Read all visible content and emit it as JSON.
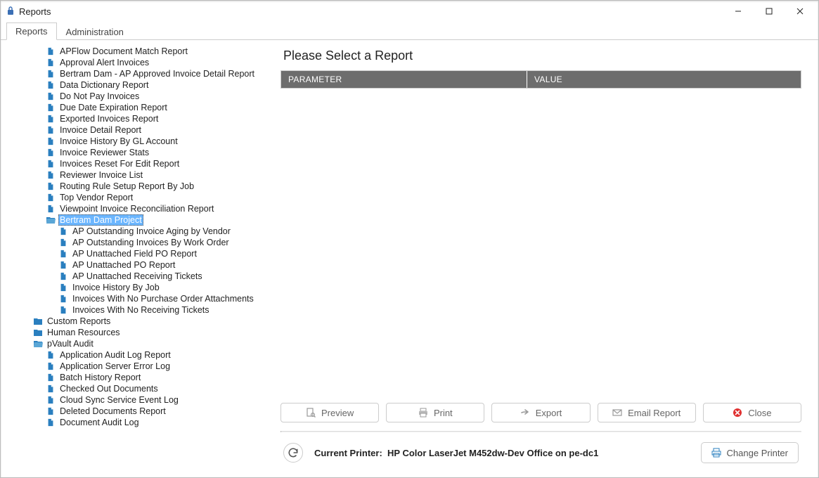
{
  "window": {
    "title": "Reports"
  },
  "tabs": {
    "reports": "Reports",
    "administration": "Administration",
    "active": "reports"
  },
  "tree": [
    {
      "depth": 2,
      "icon": "file",
      "label": "APFlow Document Match Report"
    },
    {
      "depth": 2,
      "icon": "file",
      "label": "Approval Alert Invoices"
    },
    {
      "depth": 2,
      "icon": "file",
      "label": "Bertram Dam - AP Approved Invoice Detail Report"
    },
    {
      "depth": 2,
      "icon": "file",
      "label": "Data Dictionary Report"
    },
    {
      "depth": 2,
      "icon": "file",
      "label": "Do Not Pay Invoices"
    },
    {
      "depth": 2,
      "icon": "file",
      "label": "Due Date Expiration Report"
    },
    {
      "depth": 2,
      "icon": "file",
      "label": "Exported Invoices Report"
    },
    {
      "depth": 2,
      "icon": "file",
      "label": "Invoice Detail Report"
    },
    {
      "depth": 2,
      "icon": "file",
      "label": "Invoice History By GL Account"
    },
    {
      "depth": 2,
      "icon": "file",
      "label": "Invoice Reviewer Stats"
    },
    {
      "depth": 2,
      "icon": "file",
      "label": "Invoices Reset For Edit Report"
    },
    {
      "depth": 2,
      "icon": "file",
      "label": "Reviewer Invoice List"
    },
    {
      "depth": 2,
      "icon": "file",
      "label": "Routing Rule Setup Report By Job"
    },
    {
      "depth": 2,
      "icon": "file",
      "label": "Top Vendor Report"
    },
    {
      "depth": 2,
      "icon": "file",
      "label": "Viewpoint Invoice Reconciliation Report"
    },
    {
      "depth": 2,
      "icon": "folder-open",
      "label": "Bertram Dam Project",
      "selected": true
    },
    {
      "depth": 3,
      "icon": "file",
      "label": "AP Outstanding Invoice Aging by Vendor"
    },
    {
      "depth": 3,
      "icon": "file",
      "label": "AP Outstanding Invoices By Work Order"
    },
    {
      "depth": 3,
      "icon": "file",
      "label": "AP Unattached Field PO Report"
    },
    {
      "depth": 3,
      "icon": "file",
      "label": "AP Unattached PO Report"
    },
    {
      "depth": 3,
      "icon": "file",
      "label": "AP Unattached Receiving Tickets"
    },
    {
      "depth": 3,
      "icon": "file",
      "label": "Invoice History By Job"
    },
    {
      "depth": 3,
      "icon": "file",
      "label": "Invoices With No Purchase Order Attachments"
    },
    {
      "depth": 3,
      "icon": "file",
      "label": "Invoices With No Receiving Tickets"
    },
    {
      "depth": 1,
      "icon": "folder",
      "label": "Custom Reports"
    },
    {
      "depth": 1,
      "icon": "folder",
      "label": "Human Resources"
    },
    {
      "depth": 1,
      "icon": "folder-open",
      "label": "pVault Audit"
    },
    {
      "depth": 2,
      "icon": "file",
      "label": "Application Audit Log Report"
    },
    {
      "depth": 2,
      "icon": "file",
      "label": "Application Server Error Log"
    },
    {
      "depth": 2,
      "icon": "file",
      "label": "Batch History Report"
    },
    {
      "depth": 2,
      "icon": "file",
      "label": "Checked Out Documents"
    },
    {
      "depth": 2,
      "icon": "file",
      "label": "Cloud Sync Service Event Log"
    },
    {
      "depth": 2,
      "icon": "file",
      "label": "Deleted Documents Report"
    },
    {
      "depth": 2,
      "icon": "file",
      "label": "Document Audit Log"
    }
  ],
  "main": {
    "heading": "Please Select a Report",
    "col_parameter": "PARAMETER",
    "col_value": "VALUE"
  },
  "actions": {
    "preview": "Preview",
    "print": "Print",
    "export": "Export",
    "email": "Email Report",
    "close": "Close"
  },
  "footer": {
    "printer_label": "Current Printer:",
    "printer_value": "HP Color LaserJet M452dw-Dev Office on pe-dc1",
    "change_printer": "Change Printer"
  }
}
